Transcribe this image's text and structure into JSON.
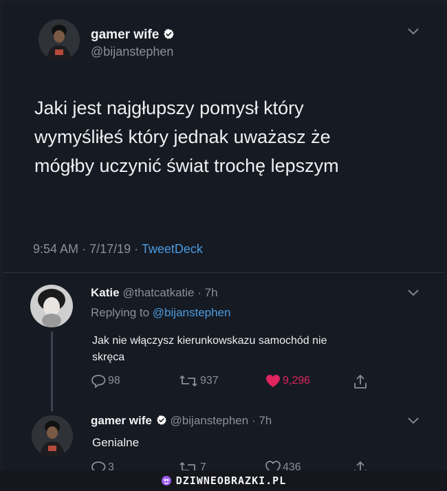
{
  "tweet": {
    "display_name": "gamer wife",
    "handle": "@bijanstephen",
    "text_lines": [
      "Jaki jest najgłupszy pomysł który",
      "wymyśliłeś który jednak uważasz że",
      "mógłby uczynić świat trochę lepszym"
    ],
    "time": "9:54 AM",
    "date": "7/17/19",
    "separator": "·",
    "client": "TweetDeck"
  },
  "replies": [
    {
      "display_name": "Katie",
      "handle": "@thatcatkatie",
      "age": "· 7h",
      "replying_label": "Replying to",
      "replying_handle": "@bijanstephen",
      "text_lines": [
        "Jak nie włączysz kierunkowskazu samochód nie",
        "skręca"
      ],
      "reply_count": "98",
      "retweet_count": "937",
      "like_count": "9,296",
      "liked": true
    },
    {
      "display_name": "gamer wife",
      "handle": "@bijanstephen",
      "age": "· 7h",
      "text": "Genialne",
      "reply_count": "3",
      "retweet_count": "7",
      "like_count": "436",
      "liked": false
    }
  ],
  "colors": {
    "background": "#161a22",
    "link_blue": "#4a9be0",
    "like_red": "#e0245e",
    "muted": "#8a9099",
    "verified_badge": "#ffffff"
  },
  "icons": [
    "chevron-down-icon",
    "verified-badge-icon",
    "reply-icon",
    "retweet-icon",
    "heart-icon",
    "share-icon",
    "site-logo-icon"
  ],
  "watermark": {
    "text": "DZIWNEOBRAZKI.PL"
  }
}
